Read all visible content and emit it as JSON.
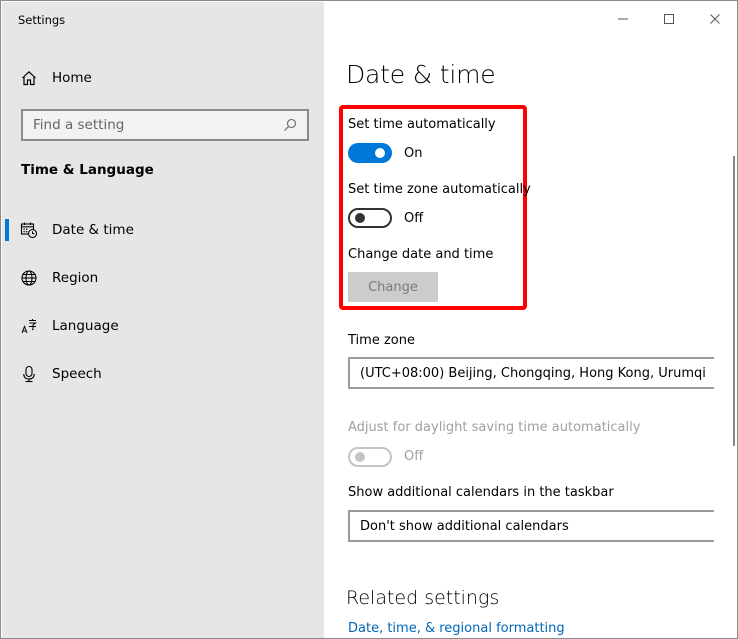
{
  "window": {
    "title": "Settings",
    "controls": {
      "minimize": "minimize-icon",
      "maximize": "maximize-icon",
      "close": "close-icon"
    }
  },
  "sidebar": {
    "home_label": "Home",
    "search": {
      "placeholder": "Find a setting",
      "value": ""
    },
    "section_title": "Time & Language",
    "items": [
      {
        "label": "Date & time",
        "icon": "calendar-clock-icon",
        "active": true
      },
      {
        "label": "Region",
        "icon": "globe-icon",
        "active": false
      },
      {
        "label": "Language",
        "icon": "language-icon",
        "active": false
      },
      {
        "label": "Speech",
        "icon": "microphone-icon",
        "active": false
      }
    ]
  },
  "main": {
    "page_title": "Date & time",
    "set_time_auto": {
      "label": "Set time automatically",
      "state": "On",
      "value": true
    },
    "set_tz_auto": {
      "label": "Set time zone automatically",
      "state": "Off",
      "value": false
    },
    "change_datetime": {
      "label": "Change date and time",
      "button": "Change",
      "enabled": false
    },
    "time_zone": {
      "label": "Time zone",
      "value": "(UTC+08:00) Beijing, Chongqing, Hong Kong, Urumqi"
    },
    "daylight": {
      "label": "Adjust for daylight saving time automatically",
      "state": "Off",
      "value": false,
      "enabled": false
    },
    "calendars": {
      "label": "Show additional calendars in the taskbar",
      "value": "Don't show additional calendars"
    },
    "related": {
      "title": "Related settings",
      "links": [
        "Date, time, & regional formatting"
      ]
    },
    "highlight_color": "#ff0000",
    "accent_color": "#0078d7"
  }
}
